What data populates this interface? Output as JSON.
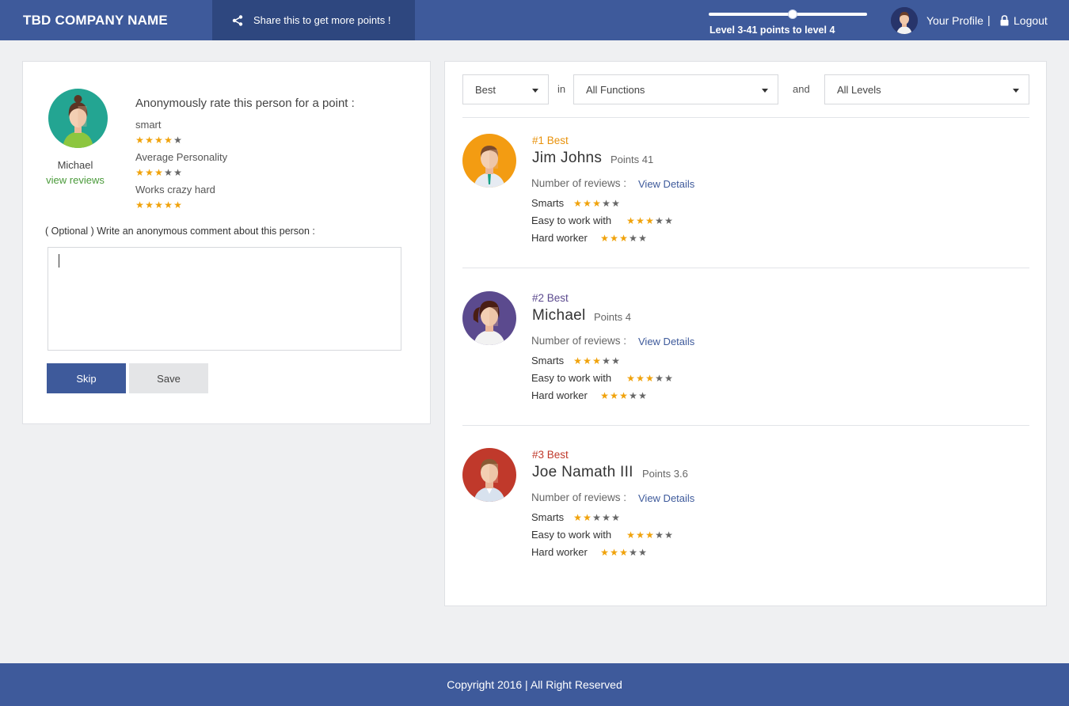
{
  "header": {
    "brand": "TBD COMPANY NAME",
    "share_label": "Share this to get more points !",
    "level_text": "Level 3-41 points to level 4",
    "level_progress": 0.53,
    "profile_label": "Your Profile",
    "separator": "|",
    "logout_label": "Logout"
  },
  "rate_panel": {
    "person_name": "Michael",
    "view_reviews_label": "view reviews",
    "title": "Anonymously rate this person for a point :",
    "criteria": [
      {
        "label": "smart",
        "rating": 4
      },
      {
        "label": "Average Personality",
        "rating": 3
      },
      {
        "label": "Works crazy hard",
        "rating": 5
      }
    ],
    "comment_label": "( Optional ) Write an anonymous comment about this person :",
    "comment_value": "",
    "skip_label": "Skip",
    "save_label": "Save"
  },
  "filters": {
    "sort_value": "Best",
    "word_in": "in",
    "function_value": "All Functions",
    "word_and": "and",
    "level_value": "All Levels"
  },
  "leaderboard": [
    {
      "rank": "#1 Best",
      "rank_color": "#e8920c",
      "name": "Jim Johns",
      "points": "Points 41",
      "reviews_label": "Number of reviews :",
      "view_details": "View Details",
      "metrics": [
        {
          "label": "Smarts",
          "rating": 3
        },
        {
          "label": "Easy to work with",
          "rating": 3
        },
        {
          "label": "Hard worker",
          "rating": 3
        }
      ]
    },
    {
      "rank": "#2 Best",
      "rank_color": "#5b4a8e",
      "name": "Michael",
      "points": "Points 4",
      "reviews_label": "Number of reviews :",
      "view_details": "View Details",
      "metrics": [
        {
          "label": "Smarts",
          "rating": 3
        },
        {
          "label": "Easy to work with",
          "rating": 3
        },
        {
          "label": "Hard worker",
          "rating": 3
        }
      ]
    },
    {
      "rank": "#3 Best",
      "rank_color": "#c0392b",
      "name": "Joe Namath III",
      "points": "Points 3.6",
      "reviews_label": "Number of reviews :",
      "view_details": "View Details",
      "metrics": [
        {
          "label": "Smarts",
          "rating": 2
        },
        {
          "label": "Easy to work with",
          "rating": 3
        },
        {
          "label": "Hard worker",
          "rating": 3
        }
      ]
    }
  ],
  "footer": {
    "copyright": "Copyright 2016 | All Right Reserved"
  },
  "colors": {
    "brand_blue": "#3e5a9b",
    "star_on": "#f0a20a",
    "star_off": "#666666"
  }
}
